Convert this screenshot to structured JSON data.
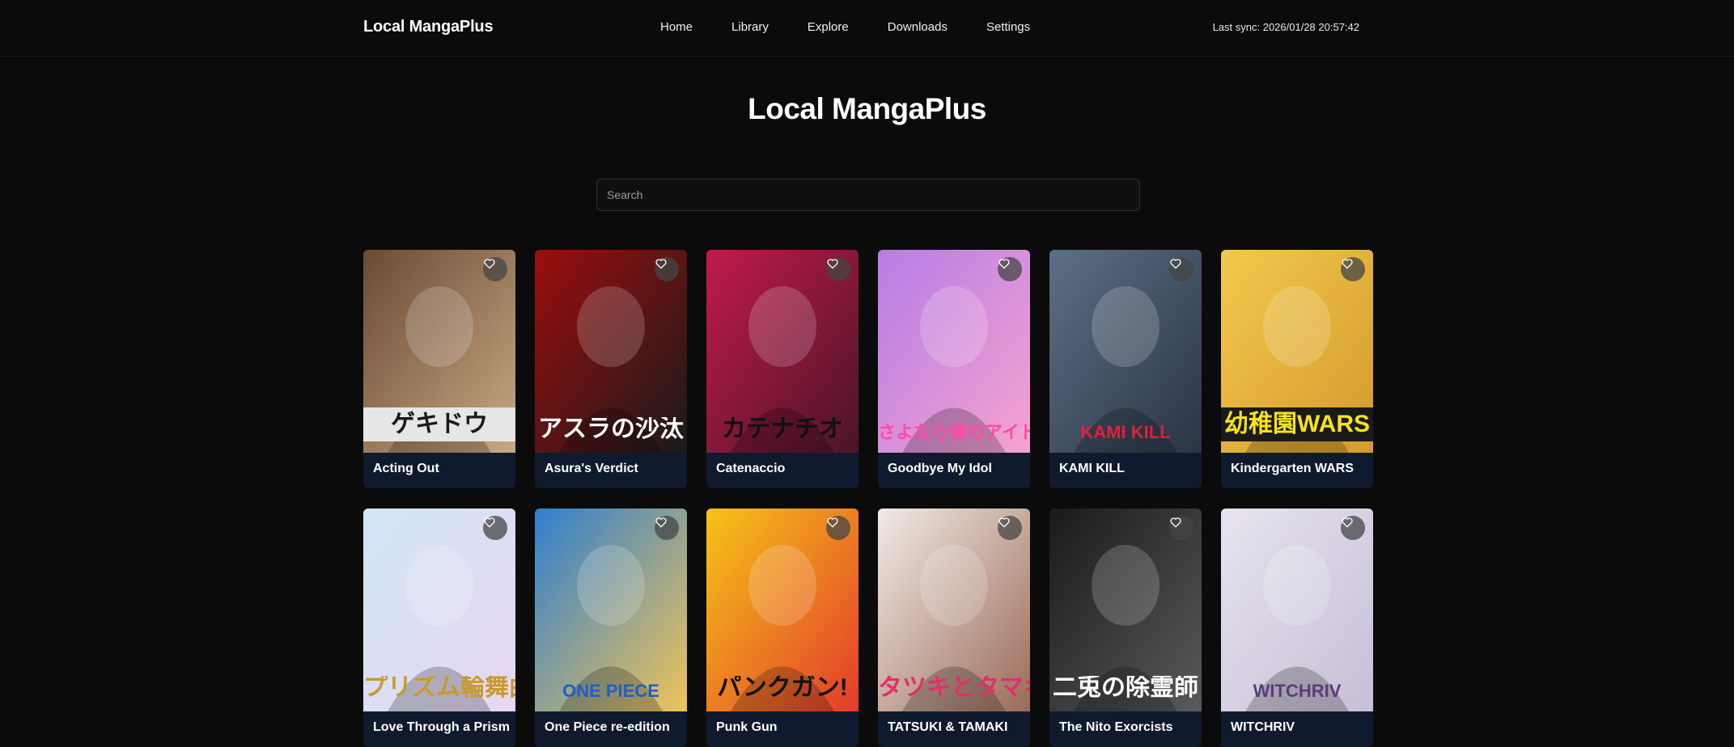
{
  "app": {
    "brand": "Local MangaPlus",
    "last_sync": "Last sync: 2026/01/28 20:57:42"
  },
  "nav": {
    "items": [
      {
        "label": "Home"
      },
      {
        "label": "Library"
      },
      {
        "label": "Explore"
      },
      {
        "label": "Downloads"
      },
      {
        "label": "Settings"
      }
    ]
  },
  "page": {
    "title": "Local MangaPlus",
    "search_placeholder": "Search"
  },
  "mangas": [
    {
      "title": "Acting Out",
      "cover_text": "ゲキドウ",
      "colors": [
        "#6b4a34",
        "#c9a983"
      ],
      "text_color": "#1a1a1a",
      "text_bg": "#e6e6e6"
    },
    {
      "title": "Asura's Verdict",
      "cover_text": "アスラの沙汰",
      "colors": [
        "#9c0e0e",
        "#1a1a1a"
      ],
      "text_color": "#ffffff",
      "text_bg": ""
    },
    {
      "title": "Catenaccio",
      "cover_text": "カテナチオ",
      "colors": [
        "#c21a4b",
        "#4a1526"
      ],
      "text_color": "#111111",
      "text_bg": ""
    },
    {
      "title": "Goodbye My Idol",
      "cover_text": "さよなら僕のアイドル",
      "colors": [
        "#b77de6",
        "#f5a3cf"
      ],
      "text_color": "#ff4aa5",
      "text_bg": ""
    },
    {
      "title": "KAMI KILL",
      "cover_text": "KAMI KILL",
      "colors": [
        "#5d6f85",
        "#2a3545"
      ],
      "text_color": "#e0203c",
      "text_bg": ""
    },
    {
      "title": "Kindergarten WARS",
      "cover_text": "幼稚園WARS",
      "colors": [
        "#f2c94c",
        "#d59a2c"
      ],
      "text_color": "#f7e21b",
      "text_bg": "#1a1a1a"
    },
    {
      "title": "Love Through a Prism",
      "cover_text": "プリズム輪舞曲",
      "colors": [
        "#cfe6f5",
        "#e8d6f2"
      ],
      "text_color": "#c79a2e",
      "text_bg": ""
    },
    {
      "title": "One Piece re-edition",
      "cover_text": "ONE PIECE",
      "colors": [
        "#2e7fcf",
        "#f0c35a"
      ],
      "text_color": "#1c5fc9",
      "text_bg": ""
    },
    {
      "title": "Punk Gun",
      "cover_text": "パンクガン!",
      "colors": [
        "#f5c417",
        "#e33b2c"
      ],
      "text_color": "#111111",
      "text_bg": ""
    },
    {
      "title": "TATSUKI & TAMAKI",
      "cover_text": "タツキとタマキ",
      "colors": [
        "#f2ebe6",
        "#9a6b58"
      ],
      "text_color": "#e0306a",
      "text_bg": ""
    },
    {
      "title": "The Nito Exorcists",
      "cover_text": "二兎の除霊師",
      "colors": [
        "#1a1a1a",
        "#5a5a5a"
      ],
      "text_color": "#ffffff",
      "text_bg": ""
    },
    {
      "title": "WITCHRIV",
      "cover_text": "WITCHRIV",
      "colors": [
        "#e7e3ee",
        "#c6bfd6"
      ],
      "text_color": "#5b3b7c",
      "text_bg": ""
    }
  ],
  "icons": {
    "favorite": "heart-outline-icon"
  }
}
